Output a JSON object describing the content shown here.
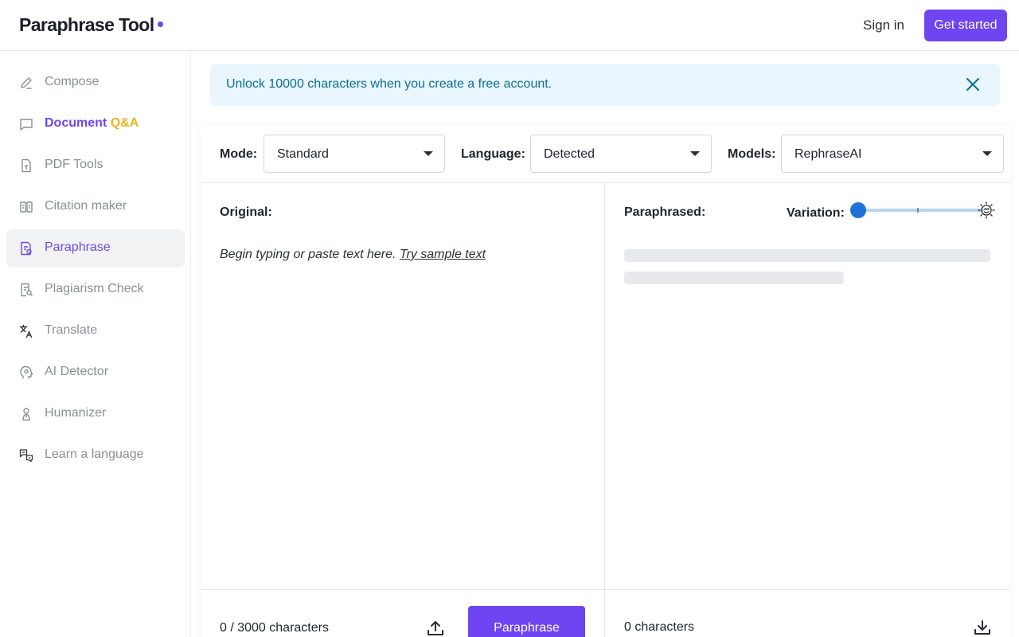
{
  "colors": {
    "brand": "#6e45f0",
    "banner_bg": "#e9f6fd",
    "banner_text": "#0b6e98",
    "slider": "#1e74d6",
    "qa_accent": "#e8b420"
  },
  "header": {
    "logo": "Paraphrase Tool",
    "sign_in": "Sign in",
    "get_started": "Get started"
  },
  "sidebar": {
    "items": [
      {
        "label": "Compose",
        "icon": "pencil-icon"
      },
      {
        "label_part1": "Document",
        "label_part2": "Q&A",
        "icon": "chat-bubble-icon"
      },
      {
        "label": "PDF Tools",
        "icon": "pdf-file-icon"
      },
      {
        "label": "Citation maker",
        "icon": "book-icon"
      },
      {
        "label": "Paraphrase",
        "icon": "paraphrase-doc-icon",
        "active": true
      },
      {
        "label": "Plagiarism Check",
        "icon": "doc-search-icon"
      },
      {
        "label": "Translate",
        "icon": "translate-icon"
      },
      {
        "label": "AI Detector",
        "icon": "ai-head-icon"
      },
      {
        "label": "Humanizer",
        "icon": "humanizer-icon"
      },
      {
        "label": "Learn a language",
        "icon": "language-chat-icon"
      }
    ]
  },
  "banner": {
    "text": "Unlock 10000 characters when you create a free account."
  },
  "toolbar": {
    "mode_label": "Mode:",
    "mode_value": "Standard",
    "language_label": "Language:",
    "language_value": "Detected",
    "models_label": "Models:",
    "models_value": "RephraseAI"
  },
  "original": {
    "title": "Original:",
    "placeholder": "Begin typing or paste text here.",
    "sample_link": "Try sample text",
    "char_count": "0 / 3000 characters",
    "paraphrase_button": "Paraphrase"
  },
  "paraphrased": {
    "title": "Paraphrased:",
    "variation_label": "Variation:",
    "variation_level": 0,
    "char_count": "0 characters"
  }
}
